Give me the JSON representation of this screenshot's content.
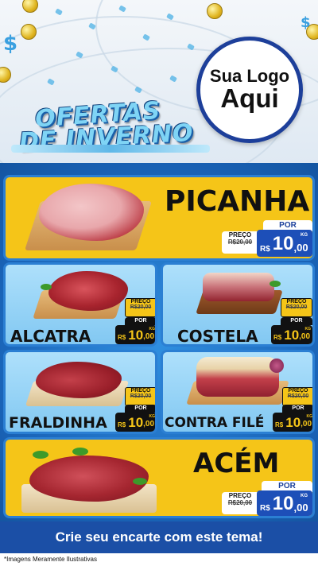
{
  "header": {
    "logo": {
      "line1": "Sua Logo",
      "line2": "Aqui"
    },
    "banner": {
      "line1": "OFERTAS",
      "line2": "DE INVERNO"
    }
  },
  "products": [
    {
      "name": "PICANHA",
      "preco_label": "PREÇO",
      "old_price": "R$20,00",
      "por_label": "POR",
      "currency": "R$",
      "price_int": "10",
      "price_dec": ",00",
      "unit": "KG"
    },
    {
      "name": "ALCATRA",
      "preco_label": "PREÇO",
      "old_price": "R$20,00",
      "por_label": "POR",
      "currency": "R$",
      "price_int": "10",
      "price_dec": ",00",
      "unit": "KG"
    },
    {
      "name": "COSTELA",
      "preco_label": "PREÇO",
      "old_price": "R$20,00",
      "por_label": "POR",
      "currency": "R$",
      "price_int": "10",
      "price_dec": ",00",
      "unit": "KG"
    },
    {
      "name": "FRALDINHA",
      "preco_label": "PREÇO",
      "old_price": "R$20,00",
      "por_label": "POR",
      "currency": "R$",
      "price_int": "10",
      "price_dec": ",00",
      "unit": "KG"
    },
    {
      "name": "CONTRA FILÉ",
      "preco_label": "PREÇO",
      "old_price": "R$20,00",
      "por_label": "POR",
      "currency": "R$",
      "price_int": "10",
      "price_dec": ",00",
      "unit": "KG"
    },
    {
      "name": "ACÉM",
      "preco_label": "PREÇO",
      "old_price": "R$20,00",
      "por_label": "POR",
      "currency": "R$",
      "price_int": "10",
      "price_dec": ",00",
      "unit": "KG"
    }
  ],
  "footer": {
    "cta": "Crie seu encarte com este tema!"
  },
  "disclaimer": "*Imagens Meramente Ilustrativas",
  "colors": {
    "card_yellow": "#f5c518",
    "card_light_blue": "#aee0fb",
    "price_blue": "#1d4fb8",
    "background_blue": "#1c6fbf"
  }
}
